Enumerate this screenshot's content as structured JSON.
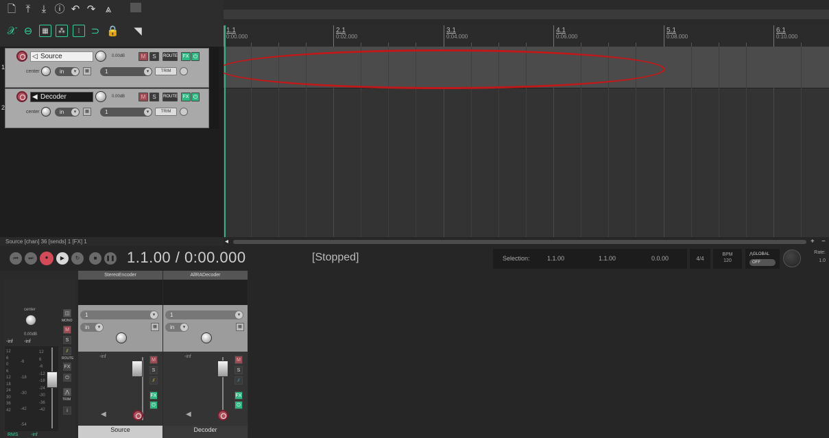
{
  "toolbar": {
    "row1_icons": [
      "new-project-icon",
      "open-project-icon",
      "save-project-icon",
      "info-icon",
      "undo-icon",
      "redo-icon",
      "metronome-icon",
      "grid-icon"
    ],
    "row2_icons": [
      "ripple-icon",
      "link-icon",
      "grid-snap-icon",
      "envelope-icon",
      "marker-icon",
      "loop-icon",
      "lock-icon",
      "scissors-icon"
    ]
  },
  "ruler": {
    "marks": [
      {
        "measure": "1.1",
        "time": "0:00.000"
      },
      {
        "measure": "2.1",
        "time": "0:02.000"
      },
      {
        "measure": "3.1",
        "time": "0:04.000"
      },
      {
        "measure": "4.1",
        "time": "0:06.000"
      },
      {
        "measure": "5.1",
        "time": "0:08.000"
      },
      {
        "measure": "6.1",
        "time": "0:10.000"
      }
    ]
  },
  "tracks": [
    {
      "number": "1",
      "name": "Source",
      "volume": "0.00dB",
      "pan": "center",
      "input": "in",
      "channel": "1",
      "mute": "M",
      "solo": "S",
      "route": "ROUTE",
      "fx": "FX",
      "trim": "TRIM"
    },
    {
      "number": "2",
      "name": "Decoder",
      "volume": "0.00dB",
      "pan": "center",
      "input": "in",
      "channel": "1",
      "mute": "M",
      "solo": "S",
      "route": "ROUTE",
      "fx": "FX",
      "trim": "TRIM"
    }
  ],
  "status_line": "Source [chan] 36 [sends] 1 [FX] 1",
  "transport": {
    "timecode": "1.1.00 / 0:00.000",
    "state": "[Stopped]",
    "selection_label": "Selection:",
    "selection_start": "1.1.00",
    "selection_end": "1.1.00",
    "selection_length": "0.0.00",
    "time_signature": "4/4",
    "bpm_label": "BPM",
    "bpm_value": "120",
    "global_label": "GLOBAL",
    "global_value": "OFF",
    "rate_label": "Rate:",
    "rate_value": "1.0"
  },
  "mixer": {
    "master": {
      "pan": "center",
      "volume": "0.00dB",
      "peak_left": "-inf",
      "peak_right": "-inf",
      "mono": "MONO",
      "mute": "M",
      "solo": "S",
      "route": "ROUTE",
      "fx": "FX",
      "trim": "TRIM",
      "rms": "RMS",
      "rms_value": "-inf",
      "scale_left": [
        "12",
        "6",
        "0",
        "6",
        "12",
        "18",
        "24",
        "30",
        "36",
        "42"
      ],
      "scale_mid": [
        "-6",
        "-18",
        "-30",
        "-42",
        "-54"
      ],
      "scale_right": [
        "12",
        "6",
        "-6",
        "-12",
        "-18",
        "-24",
        "-30",
        "-36",
        "-42"
      ]
    },
    "strips": [
      {
        "fx_name": "StereoEncoder",
        "channel": "1",
        "input": "in",
        "peak": "-inf",
        "mute": "M",
        "solo": "S",
        "fx": "FX",
        "name": "Source"
      },
      {
        "fx_name": "AllRADecoder",
        "channel": "1",
        "input": "in",
        "peak": "-inf",
        "mute": "M",
        "solo": "S",
        "fx": "FX",
        "name": "Decoder"
      }
    ]
  },
  "colors": {
    "accent": "#2fd39a",
    "record": "#d34a58",
    "annotation": "#c01818"
  }
}
